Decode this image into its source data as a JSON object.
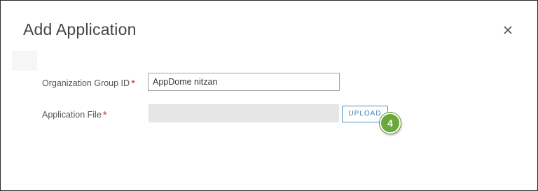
{
  "dialog": {
    "title": "Add Application",
    "close_icon": "close-icon"
  },
  "form": {
    "org_group_label": "Organization Group ID",
    "org_group_value": "AppDome nitzan",
    "app_file_label": "Application File",
    "required_mark": "*",
    "upload_label": "UPLOAD"
  },
  "callout": {
    "step_number": "4"
  },
  "colors": {
    "required": "#d9342b",
    "upload_accent": "#4a90c8",
    "callout_bg": "#69a83a"
  }
}
